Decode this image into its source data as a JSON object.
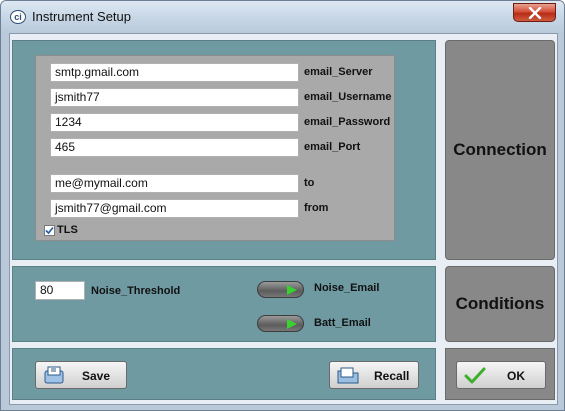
{
  "window": {
    "title": "Instrument Setup",
    "app_icon_text": "ci"
  },
  "connection": {
    "fields": [
      {
        "value": "smtp.gmail.com",
        "label": "email_Server"
      },
      {
        "value": "jsmith77",
        "label": "email_Username"
      },
      {
        "value": "1234",
        "label": "email_Password"
      },
      {
        "value": "465",
        "label": "email_Port"
      },
      {
        "value": "me@mymail.com",
        "label": "to"
      },
      {
        "value": "jsmith77@gmail.com",
        "label": "from"
      }
    ],
    "tls_label": "TLS",
    "tls_checked": true,
    "side_label": "Connection"
  },
  "conditions": {
    "noise_threshold_value": "80",
    "noise_threshold_label": "Noise_Threshold",
    "noise_email_label": "Noise_Email",
    "batt_email_label": "Batt_Email",
    "side_label": "Conditions"
  },
  "buttons": {
    "save": "Save",
    "recall": "Recall",
    "ok": "OK"
  },
  "icons": {
    "app": "ci-app-icon",
    "close": "close-x-icon",
    "save": "save-icon",
    "recall": "recall-folder-icon",
    "ok": "checkmark-icon",
    "toggle": "green-arrow-toggle-icon",
    "tls": "checkbox-check-icon"
  },
  "colors": {
    "panel": "#6f9aa2",
    "side_button": "#888888",
    "inner_panel": "#a9a9a9",
    "toggle_arrow": "#38d12f",
    "close_button": "#c8432c"
  }
}
